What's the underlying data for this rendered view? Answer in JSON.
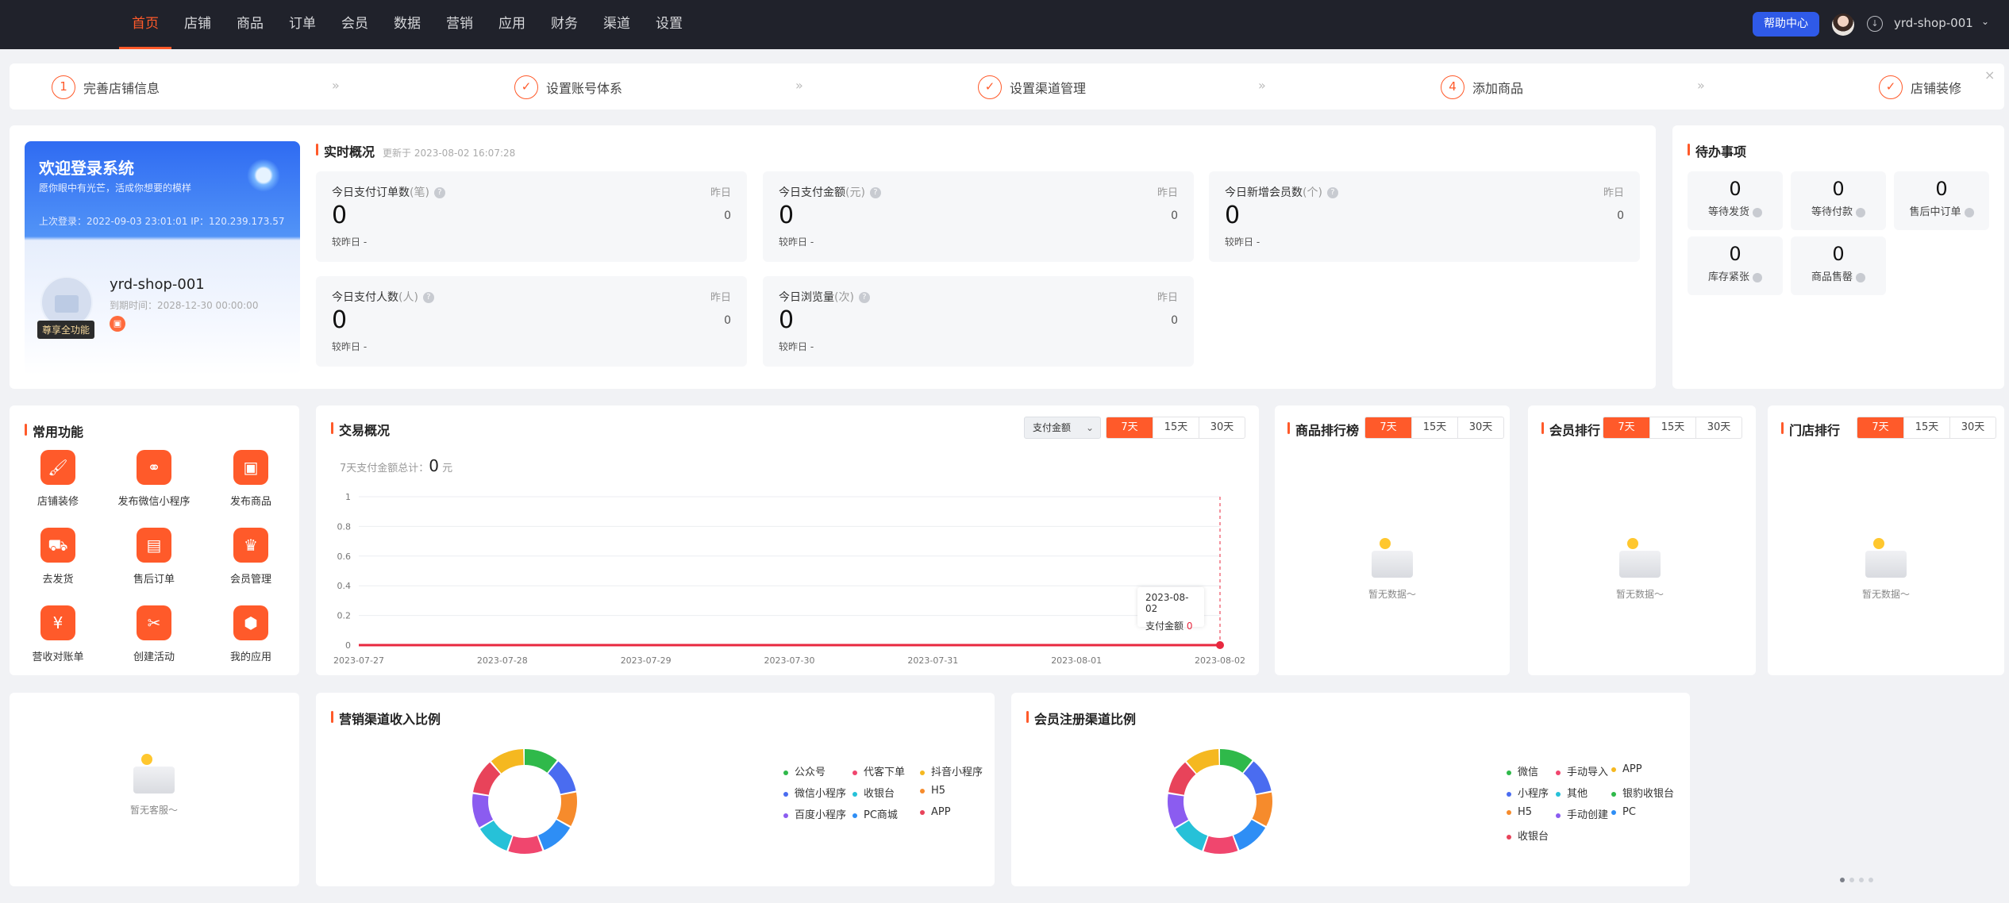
{
  "nav": {
    "items": [
      "首页",
      "店铺",
      "商品",
      "订单",
      "会员",
      "数据",
      "营销",
      "应用",
      "财务",
      "渠道",
      "设置"
    ],
    "active": 0,
    "help_label": "帮助中心",
    "shop_name": "yrd-shop-001"
  },
  "steps": [
    {
      "index": "1",
      "label": "完善店铺信息",
      "done": false
    },
    {
      "index": "✓",
      "label": "设置账号体系",
      "done": true
    },
    {
      "index": "✓",
      "label": "设置渠道管理",
      "done": true
    },
    {
      "index": "4",
      "label": "添加商品",
      "done": false
    },
    {
      "index": "✓",
      "label": "店铺装修",
      "done": true
    }
  ],
  "welcome": {
    "title": "欢迎登录系统",
    "subtitle": "愿你眼中有光芒，活成你想要的模样",
    "last_login": "上次登录：2022-09-03 23:01:01 IP：120.239.173.57",
    "shop_name": "yrd-shop-001",
    "expire": "到期时间：2028-12-30 00:00:00",
    "badge": "尊享全功能"
  },
  "realtime": {
    "title": "实时概况",
    "updated": "更新于 2023-08-02 16:07:28",
    "yesterday_label": "昨日",
    "compare_label": "较昨日 -",
    "stats": [
      {
        "label": "今日支付订单数",
        "unit": "(笔)",
        "value": "0",
        "yesterday": "0"
      },
      {
        "label": "今日支付金额",
        "unit": "(元)",
        "value": "0",
        "yesterday": "0"
      },
      {
        "label": "今日新增会员数",
        "unit": "(个)",
        "value": "0",
        "yesterday": "0"
      },
      {
        "label": "今日支付人数",
        "unit": "(人)",
        "value": "0",
        "yesterday": "0"
      },
      {
        "label": "今日浏览量",
        "unit": "(次)",
        "value": "0",
        "yesterday": "0"
      }
    ]
  },
  "todo": {
    "title": "待办事项",
    "items": [
      {
        "count": "0",
        "label": "等待发货"
      },
      {
        "count": "0",
        "label": "等待付款"
      },
      {
        "count": "0",
        "label": "售后中订单"
      },
      {
        "count": "0",
        "label": "库存紧张"
      },
      {
        "count": "0",
        "label": "商品售罄"
      }
    ]
  },
  "functions": {
    "title": "常用功能",
    "items": [
      {
        "label": "店铺装修",
        "icon": "paint-roller-icon",
        "glyph": "🖌"
      },
      {
        "label": "发布微信小程序",
        "icon": "mini-program-icon",
        "glyph": "⚭"
      },
      {
        "label": "发布商品",
        "icon": "publish-goods-icon",
        "glyph": "▣"
      },
      {
        "label": "去发货",
        "icon": "truck-icon",
        "glyph": "⛟"
      },
      {
        "label": "售后订单",
        "icon": "after-sale-icon",
        "glyph": "▤"
      },
      {
        "label": "会员管理",
        "icon": "crown-icon",
        "glyph": "♛"
      },
      {
        "label": "营收对账单",
        "icon": "yuan-bill-icon",
        "glyph": "¥"
      },
      {
        "label": "创建活动",
        "icon": "ticket-icon",
        "glyph": "✂"
      },
      {
        "label": "我的应用",
        "icon": "cube-icon",
        "glyph": "⬢"
      }
    ]
  },
  "trade": {
    "title": "交易概况",
    "select_label": "支付金额",
    "ranges": [
      "7天",
      "15天",
      "30天"
    ],
    "total_label": "7天支付金额总计：",
    "total_value": "0",
    "total_unit": "元",
    "tooltip_date": "2023-08-02",
    "tooltip_label": "支付金额",
    "tooltip_value": "0"
  },
  "chart_data": {
    "type": "line",
    "x": [
      "2023-07-27",
      "2023-07-28",
      "2023-07-29",
      "2023-07-30",
      "2023-07-31",
      "2023-08-01",
      "2023-08-02"
    ],
    "series": [
      {
        "name": "支付金额",
        "values": [
          0,
          0,
          0,
          0,
          0,
          0,
          0
        ]
      }
    ],
    "y_ticks": [
      "0",
      "0.2",
      "0.4",
      "0.6",
      "0.8",
      "1"
    ],
    "ylim": [
      0,
      1
    ],
    "grid": true,
    "color": "#e8283f"
  },
  "rankings": [
    {
      "title": "商品排行榜",
      "ranges": [
        "7天",
        "15天",
        "30天"
      ],
      "empty": "暂无数据～"
    },
    {
      "title": "会员排行",
      "ranges": [
        "7天",
        "15天",
        "30天"
      ],
      "empty": "暂无数据～"
    },
    {
      "title": "门店排行",
      "ranges": [
        "7天",
        "15天",
        "30天"
      ],
      "empty": "暂无数据～"
    }
  ],
  "service": {
    "empty": "暂无客服～"
  },
  "channel_income": {
    "title": "营销渠道收入比例",
    "legend": [
      {
        "label": "公众号",
        "color": "#2fb94a"
      },
      {
        "label": "代客下单",
        "color": "#f0466e"
      },
      {
        "label": "抖音小程序",
        "color": "#f5b820"
      },
      {
        "label": "微信小程序",
        "color": "#4a6cf0"
      },
      {
        "label": "收银台",
        "color": "#26c1d8"
      },
      {
        "label": "H5",
        "color": "#f68b2c"
      },
      {
        "label": "百度小程序",
        "color": "#8b5cf0"
      },
      {
        "label": "PC商城",
        "color": "#2e8ef5"
      },
      {
        "label": "APP",
        "color": "#e8435a"
      }
    ]
  },
  "member_channel": {
    "title": "会员注册渠道比例",
    "legend": [
      {
        "label": "微信",
        "color": "#2fb94a"
      },
      {
        "label": "手动导入",
        "color": "#f0466e"
      },
      {
        "label": "APP",
        "color": "#f5b820"
      },
      {
        "label": "小程序",
        "color": "#4a6cf0"
      },
      {
        "label": "其他",
        "color": "#26c1d8"
      },
      {
        "label": "银豹收银台",
        "color": "#2fb94a"
      },
      {
        "label": "H5",
        "color": "#f68b2c"
      },
      {
        "label": "手动创建",
        "color": "#8b5cf0"
      },
      {
        "label": "PC",
        "color": "#2e8ef5"
      },
      {
        "label": "收银台",
        "color": "#e8435a"
      }
    ]
  },
  "donut_colors": [
    "#2fb94a",
    "#4a6cf0",
    "#f68b2c",
    "#2e8ef5",
    "#f0466e",
    "#26c1d8",
    "#8b5cf0",
    "#e8435a",
    "#f5b820"
  ]
}
